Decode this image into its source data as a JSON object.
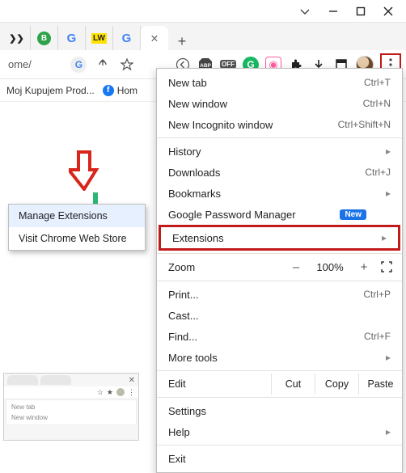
{
  "window_controls": {
    "minimize": "–",
    "maximize": "▢",
    "close": "✕",
    "dropdown": "⌄"
  },
  "tabs": {
    "items": [
      {
        "favicon": "arrows"
      },
      {
        "favicon": "b-green"
      },
      {
        "favicon": "google"
      },
      {
        "favicon": "lw"
      },
      {
        "favicon": "google"
      }
    ],
    "active_index": 5,
    "add_label": "+"
  },
  "address_bar": {
    "text": "ome/"
  },
  "toolbar_icons": {
    "google_lens": "G",
    "share": "share",
    "star": "star",
    "back": "back",
    "abp": "ABP",
    "off": "OFF",
    "grammarly": "G",
    "loom": "◎",
    "puzzle": "puzzle",
    "download": "download",
    "history_box": "history",
    "avatar": "avatar",
    "kebab": "kebab"
  },
  "bookmarks": {
    "items": [
      {
        "label": "Moj Kupujem Prod..."
      },
      {
        "icon": "facebook",
        "label": "Hom"
      }
    ]
  },
  "arrow_callout": "down-arrow",
  "extensions_flyout": {
    "items": [
      {
        "label": "Manage Extensions"
      },
      {
        "label": "Visit Chrome Web Store"
      }
    ]
  },
  "chrome_menu": {
    "new_tab": {
      "label": "New tab",
      "shortcut": "Ctrl+T"
    },
    "new_window": {
      "label": "New window",
      "shortcut": "Ctrl+N"
    },
    "incognito": {
      "label": "New Incognito window",
      "shortcut": "Ctrl+Shift+N"
    },
    "history": {
      "label": "History"
    },
    "downloads": {
      "label": "Downloads",
      "shortcut": "Ctrl+J"
    },
    "bookmarks_item": {
      "label": "Bookmarks"
    },
    "gpm": {
      "label": "Google Password Manager",
      "badge": "New"
    },
    "extensions": {
      "label": "Extensions"
    },
    "zoom": {
      "label": "Zoom",
      "value": "100%",
      "minus": "–",
      "plus": "+"
    },
    "print": {
      "label": "Print...",
      "shortcut": "Ctrl+P"
    },
    "cast": {
      "label": "Cast..."
    },
    "find": {
      "label": "Find...",
      "shortcut": "Ctrl+F"
    },
    "more_tools": {
      "label": "More tools"
    },
    "edit": {
      "label": "Edit",
      "cut": "Cut",
      "copy": "Copy",
      "paste": "Paste"
    },
    "settings": {
      "label": "Settings"
    },
    "help": {
      "label": "Help"
    },
    "exit": {
      "label": "Exit"
    }
  },
  "mini_preview": {
    "menu_items": [
      "New tab",
      "New window"
    ]
  }
}
